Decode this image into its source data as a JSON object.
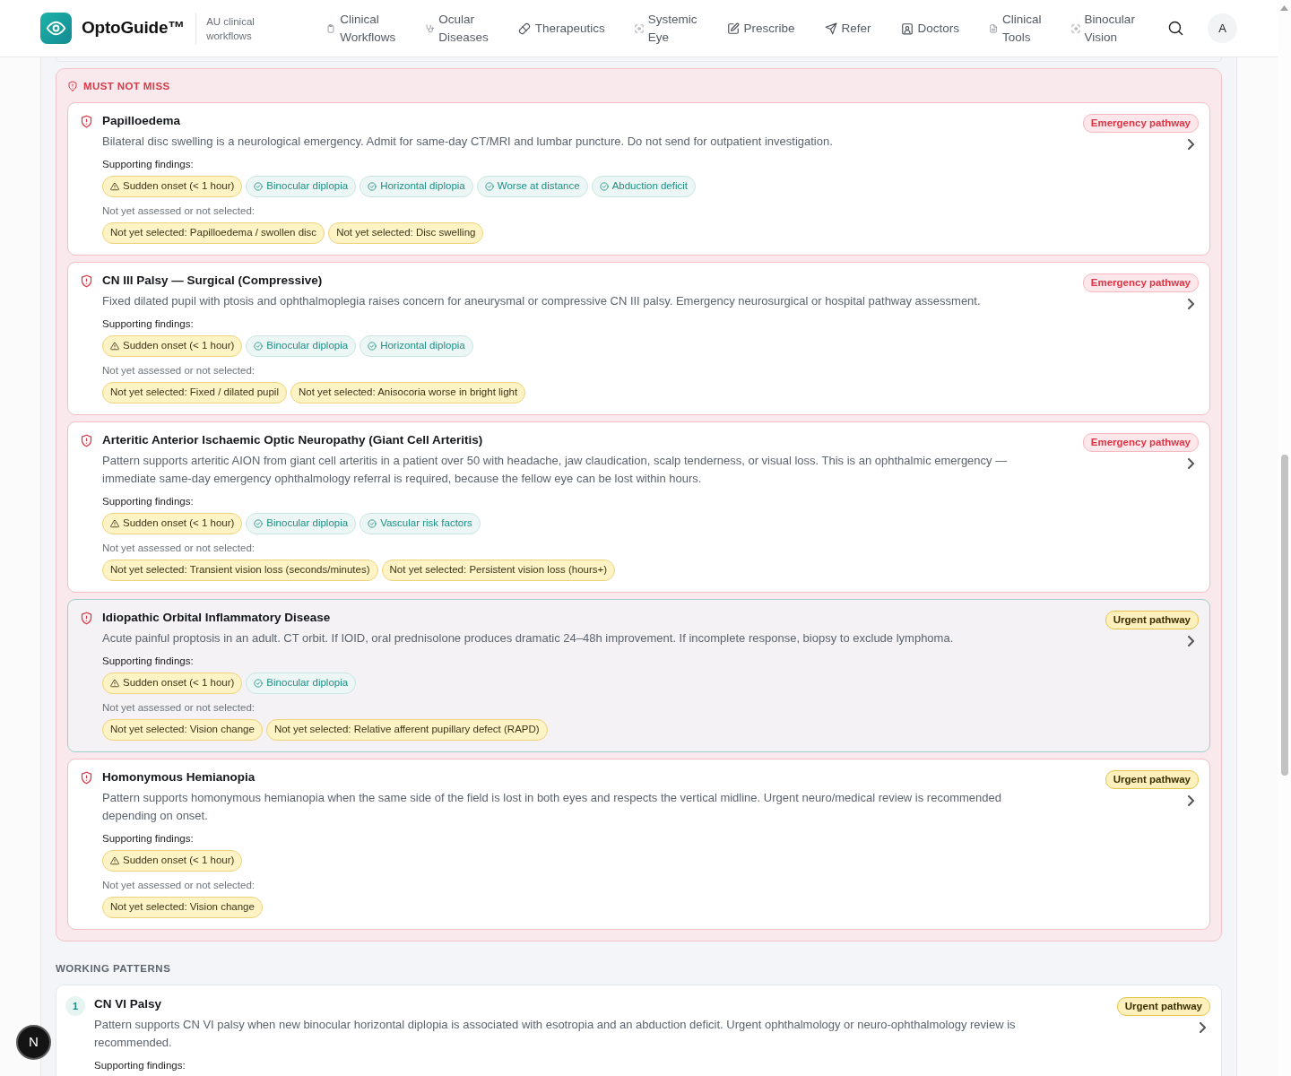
{
  "navbar": {
    "brand": "OptoGuide™",
    "tagline": "AU clinical workflows",
    "items": [
      {
        "label": "Clinical Workflows"
      },
      {
        "label": "Ocular Diseases"
      },
      {
        "label": "Therapeutics"
      },
      {
        "label": "Systemic Eye"
      },
      {
        "label": "Prescribe"
      },
      {
        "label": "Refer"
      },
      {
        "label": "Doctors"
      },
      {
        "label": "Clinical Tools"
      },
      {
        "label": "Binocular Vision"
      }
    ],
    "avatar": "A"
  },
  "must_not_miss": {
    "heading": "MUST NOT MISS",
    "cards": [
      {
        "title": "Papilloedema",
        "description": "Bilateral disc swelling is a neurological emergency. Admit for same-day CT/MRI and lumbar puncture. Do not send for outpatient investigation.",
        "pathway": {
          "label": "Emergency pathway",
          "kind": "emergency"
        },
        "selected": false,
        "supporting_label": "Supporting findings:",
        "supporting": [
          {
            "label": "Sudden onset (< 1 hour)",
            "kind": "warning"
          },
          {
            "label": "Binocular diplopia",
            "kind": "match"
          },
          {
            "label": "Horizontal diplopia",
            "kind": "match"
          },
          {
            "label": "Worse at distance",
            "kind": "match"
          },
          {
            "label": "Abduction deficit",
            "kind": "match"
          }
        ],
        "missing_label": "Not yet assessed or not selected:",
        "missing": [
          "Not yet selected: Papilloedema / swollen disc",
          "Not yet selected: Disc swelling"
        ]
      },
      {
        "title": "CN III Palsy — Surgical (Compressive)",
        "description": "Fixed dilated pupil with ptosis and ophthalmoplegia raises concern for aneurysmal or compressive CN III palsy. Emergency neurosurgical or hospital pathway assessment.",
        "pathway": {
          "label": "Emergency pathway",
          "kind": "emergency"
        },
        "selected": false,
        "supporting_label": "Supporting findings:",
        "supporting": [
          {
            "label": "Sudden onset (< 1 hour)",
            "kind": "warning"
          },
          {
            "label": "Binocular diplopia",
            "kind": "match"
          },
          {
            "label": "Horizontal diplopia",
            "kind": "match"
          }
        ],
        "missing_label": "Not yet assessed or not selected:",
        "missing": [
          "Not yet selected: Fixed / dilated pupil",
          "Not yet selected: Anisocoria worse in bright light"
        ]
      },
      {
        "title": "Arteritic Anterior Ischaemic Optic Neuropathy (Giant Cell Arteritis)",
        "description": "Pattern supports arteritic AION from giant cell arteritis in a patient over 50 with headache, jaw claudication, scalp tenderness, or visual loss. This is an ophthalmic emergency — immediate same-day emergency ophthalmology referral is required, because the fellow eye can be lost within hours.",
        "pathway": {
          "label": "Emergency pathway",
          "kind": "emergency"
        },
        "selected": false,
        "supporting_label": "Supporting findings:",
        "supporting": [
          {
            "label": "Sudden onset (< 1 hour)",
            "kind": "warning"
          },
          {
            "label": "Binocular diplopia",
            "kind": "match"
          },
          {
            "label": "Vascular risk factors",
            "kind": "match"
          }
        ],
        "missing_label": "Not yet assessed or not selected:",
        "missing": [
          "Not yet selected: Transient vision loss (seconds/minutes)",
          "Not yet selected: Persistent vision loss (hours+)"
        ]
      },
      {
        "title": "Idiopathic Orbital Inflammatory Disease",
        "description": "Acute painful proptosis in an adult. CT orbit. If IOID, oral prednisolone produces dramatic 24–48h improvement. If incomplete response, biopsy to exclude lymphoma.",
        "pathway": {
          "label": "Urgent pathway",
          "kind": "urgent"
        },
        "selected": true,
        "supporting_label": "Supporting findings:",
        "supporting": [
          {
            "label": "Sudden onset (< 1 hour)",
            "kind": "warning"
          },
          {
            "label": "Binocular diplopia",
            "kind": "match"
          }
        ],
        "missing_label": "Not yet assessed or not selected:",
        "missing": [
          "Not yet selected: Vision change",
          "Not yet selected: Relative afferent pupillary defect (RAPD)"
        ]
      },
      {
        "title": "Homonymous Hemianopia",
        "description": "Pattern supports homonymous hemianopia when the same side of the field is lost in both eyes and respects the vertical midline. Urgent neuro/medical review is recommended depending on onset.",
        "pathway": {
          "label": "Urgent pathway",
          "kind": "urgent"
        },
        "selected": false,
        "supporting_label": "Supporting findings:",
        "supporting": [
          {
            "label": "Sudden onset (< 1 hour)",
            "kind": "warning"
          }
        ],
        "missing_label": "Not yet assessed or not selected:",
        "missing": [
          "Not yet selected: Vision change"
        ]
      }
    ]
  },
  "working_patterns": {
    "heading": "WORKING PATTERNS",
    "cards": [
      {
        "number": "1",
        "title": "CN VI Palsy",
        "description": "Pattern supports CN VI palsy when new binocular horizontal diplopia is associated with esotropia and an abduction deficit. Urgent ophthalmology or neuro-ophthalmology review is recommended.",
        "pathway": {
          "label": "Urgent pathway",
          "kind": "urgent"
        },
        "supporting_label": "Supporting findings:"
      }
    ]
  },
  "dev_badge": "N"
}
